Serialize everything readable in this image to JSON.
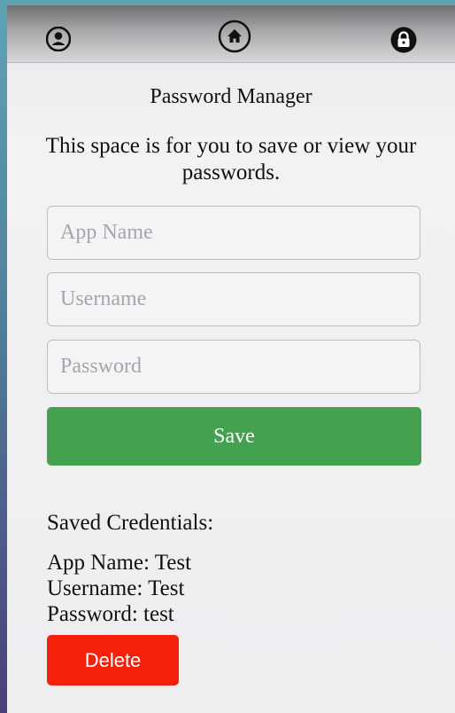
{
  "nav": {
    "user_icon": "user-icon",
    "home_icon": "home-icon",
    "lock_icon": "lock-icon"
  },
  "header": {
    "title": "Password Manager",
    "subtitle": "This space is for you to save or view your passwords."
  },
  "form": {
    "app_name_placeholder": "App Name",
    "username_placeholder": "Username",
    "password_placeholder": "Password",
    "app_name_value": "",
    "username_value": "",
    "password_value": "",
    "save_label": "Save"
  },
  "saved": {
    "heading": "Saved Credentials:",
    "app_name_line": "App Name: Test",
    "username_line": "Username: Test",
    "password_line": "Password: test",
    "delete_label": "Delete"
  },
  "colors": {
    "save_button": "#44a150",
    "delete_button": "#f5200a"
  }
}
